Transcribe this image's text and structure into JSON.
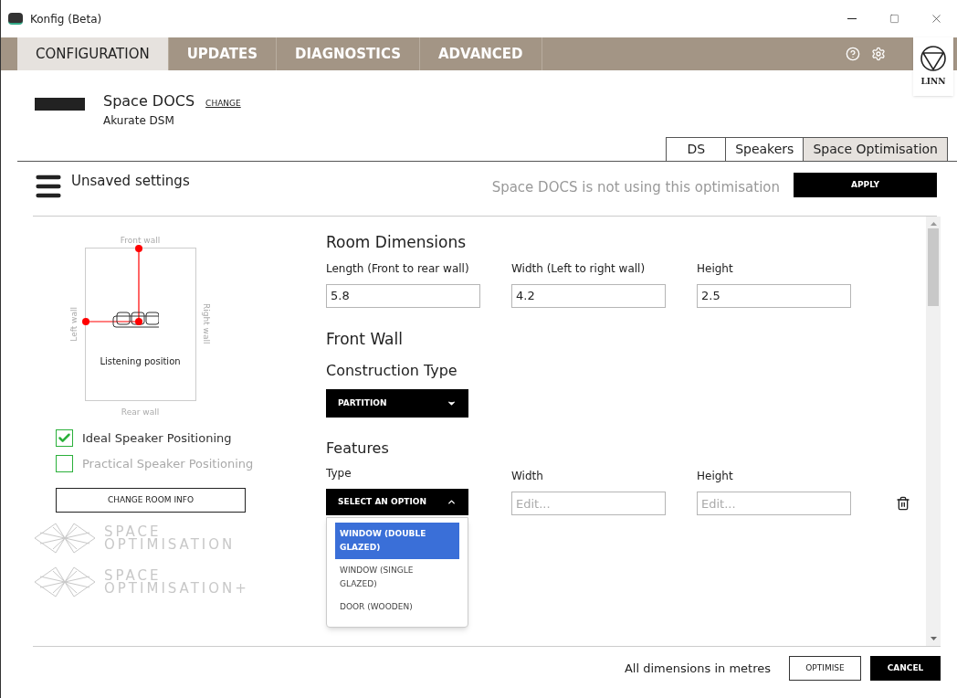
{
  "window": {
    "title": "Konfig (Beta)"
  },
  "tabs": [
    {
      "label": "CONFIGURATION",
      "selected": true
    },
    {
      "label": "UPDATES",
      "selected": false
    },
    {
      "label": "DIAGNOSTICS",
      "selected": false
    },
    {
      "label": "ADVANCED",
      "selected": false
    }
  ],
  "brand": {
    "logo": "LINN"
  },
  "device": {
    "name": "Space DOCS",
    "change": "CHANGE",
    "model": "Akurate DSM"
  },
  "subtabs": [
    {
      "label": "DS",
      "selected": false
    },
    {
      "label": "Speakers",
      "selected": false
    },
    {
      "label": "Space Optimisation",
      "selected": true
    }
  ],
  "toolbar": {
    "title": "Unsaved settings",
    "status": "Space DOCS is not using this optimisation",
    "apply": "APPLY"
  },
  "room_diagram": {
    "front": "Front wall",
    "rear": "Rear wall",
    "left": "Left wall",
    "right": "Right wall",
    "listening": "Listening position"
  },
  "positioning": [
    {
      "label": "Ideal Speaker Positioning",
      "checked": true
    },
    {
      "label": "Practical Speaker Positioning",
      "checked": false
    }
  ],
  "change_room_info": "CHANGE ROOM INFO",
  "logos": [
    {
      "line1": "SPACE",
      "line2": "OPTIMISATION"
    },
    {
      "line1": "SPACE",
      "line2": "OPTIMISATION+"
    }
  ],
  "room_dimensions": {
    "title": "Room Dimensions",
    "fields": [
      {
        "label": "Length (Front to rear wall)",
        "value": "5.8"
      },
      {
        "label": "Width (Left to right wall)",
        "value": "4.2"
      },
      {
        "label": "Height",
        "value": "2.5"
      }
    ]
  },
  "front_wall": {
    "title": "Front Wall",
    "construction_label": "Construction Type",
    "construction_value": "PARTITION"
  },
  "features": {
    "title": "Features",
    "type_label": "Type",
    "type_value": "SELECT AN OPTION",
    "expanded": true,
    "options": [
      {
        "label": "WINDOW (DOUBLE GLAZED)",
        "selected": true
      },
      {
        "label": "WINDOW (SINGLE GLAZED)",
        "selected": false
      },
      {
        "label": "DOOR (WOODEN)",
        "selected": false
      }
    ],
    "width_label": "Width",
    "width_placeholder": "Edit...",
    "height_label": "Height",
    "height_placeholder": "Edit..."
  },
  "footer": {
    "note": "All dimensions in metres",
    "optimise": "OPTIMISE",
    "cancel": "CANCEL"
  }
}
